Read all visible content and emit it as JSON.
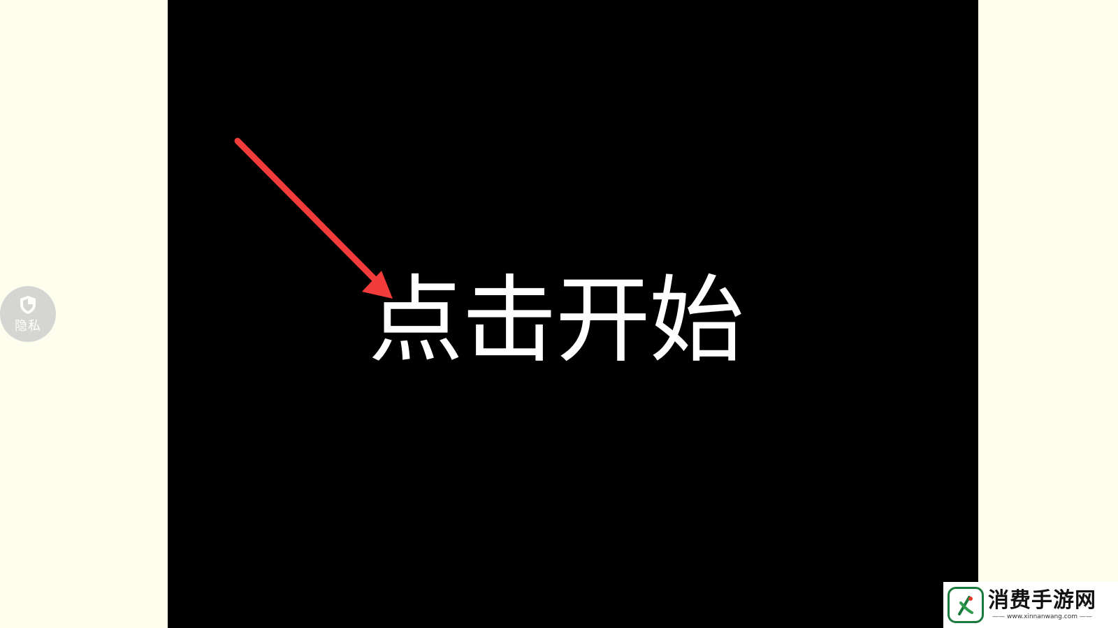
{
  "game": {
    "start_prompt": "点击开始"
  },
  "privacy": {
    "label": "隐私",
    "icon": "shield-icon"
  },
  "watermark": {
    "brand": "消费手游网",
    "url": "—— www.xinnanwang.com ——",
    "icon": "brand-logo-icon"
  },
  "colors": {
    "page_background": "#fdfeee",
    "game_background": "#000000",
    "prompt_text": "#ffffff",
    "arrow": "#f23b3b",
    "logo_green": "#1a7a3c"
  }
}
